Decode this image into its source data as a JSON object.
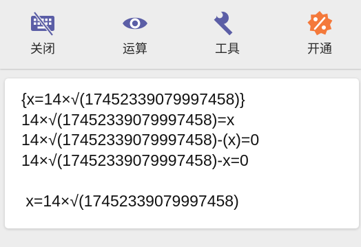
{
  "toolbar": {
    "items": [
      {
        "label": "关闭",
        "icon": "keyboard-off-icon",
        "color": "#5b5ea6"
      },
      {
        "label": "运算",
        "icon": "eye-icon",
        "color": "#5b5ea6"
      },
      {
        "label": "工具",
        "icon": "wrench-icon",
        "color": "#5b5ea6"
      },
      {
        "label": "开通",
        "icon": "percent-badge-icon",
        "color": "#f4793b"
      }
    ]
  },
  "result": {
    "lines": [
      "{x=14×√(17452339079997458)}",
      "14×√(17452339079997458)=x",
      "14×√(17452339079997458)-(x)=0",
      "14×√(17452339079997458)-x=0",
      "",
      " x=14×√(17452339079997458)"
    ]
  }
}
